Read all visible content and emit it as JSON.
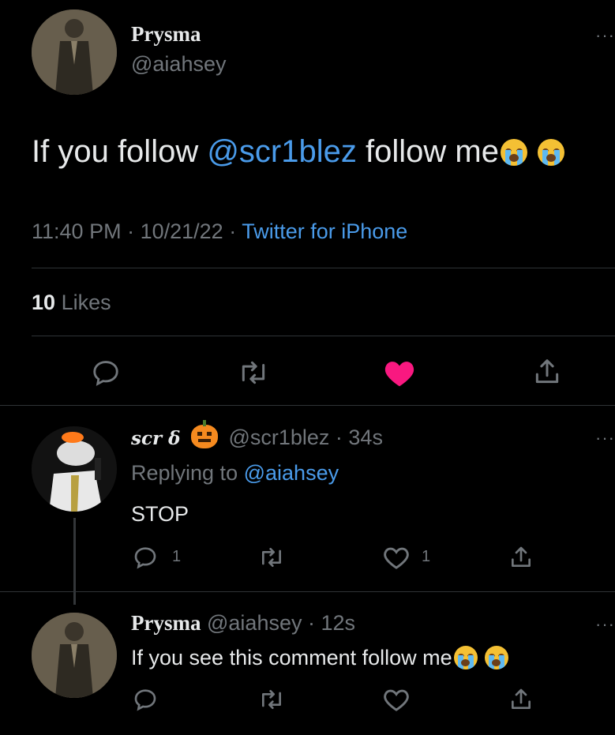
{
  "tweet": {
    "author_name": "Prysma",
    "author_handle": "@aiahsey",
    "text_before": "If you follow ",
    "mention": "@scr1blez",
    "text_after": " follow me",
    "time": "11:40 PM",
    "date": "10/21/22",
    "source": "Twitter for iPhone",
    "likes_count": "10",
    "likes_label": "Likes",
    "more": "···",
    "liked": true,
    "like_color": "#f91880"
  },
  "reply1": {
    "author_name": "scr δ",
    "author_handle": "@scr1blez",
    "age": "34s",
    "replying_to_label": "Replying to",
    "replying_to_handle": "@aiahsey",
    "text": "STOP",
    "reply_count": "1",
    "like_count": "1",
    "more": "···"
  },
  "reply2": {
    "author_name": "Prysma",
    "author_handle": "@aiahsey",
    "age": "12s",
    "text": "If you see this comment follow me",
    "more": "···"
  },
  "separator": " · ",
  "colors": {
    "background": "#000000",
    "text": "#e7e9ea",
    "secondary": "#71767b",
    "accent": "#1d9bf0",
    "divider": "#2f3336"
  }
}
